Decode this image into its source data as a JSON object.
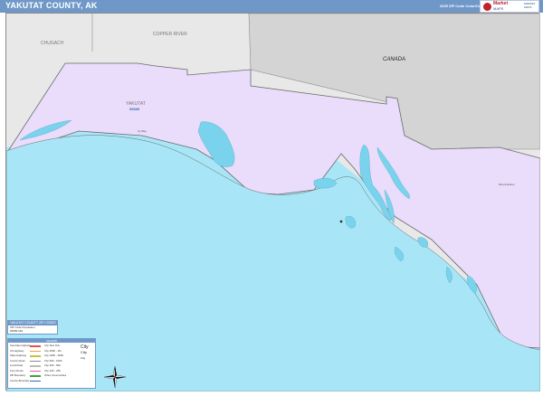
{
  "header": {
    "title": "YAKUTAT COUNTY, AK",
    "edition": "2025 ZIP Code Color/Cast Edition"
  },
  "logo": {
    "brand": "Market",
    "brand2": "MAPS",
    "sub": "MARKET MAPS"
  },
  "map": {
    "labels": {
      "chugach": "CHUGACH",
      "copper_river": "COPPER RIVER",
      "canada": "CANADA",
      "yakutat": "YAKUTAT",
      "zip": "99689",
      "small1": "Icy Bay",
      "small2": "Mount Esther"
    },
    "colors": {
      "ocean": "#a8e6f7",
      "land_county": "#eadcfb",
      "land_other": "#e8e8e8",
      "canada": "#d4d4d4",
      "water_inland": "#7ad3ec",
      "border": "#6a6a6a"
    }
  },
  "legend_zip": {
    "title": "YAKUTAT COUNTY ZIP CODES",
    "rows": [
      "ZIP Code    Population",
      "99689         662"
    ]
  },
  "legend_main": {
    "title": "LEGEND",
    "items_left": [
      "Interstate Highway",
      "US Highway",
      "State Highway",
      "County Road",
      "Local Road",
      "Ferry Route",
      "ZIP Boundary",
      "County Boundary"
    ],
    "items_right": [
      "City Size 1M+",
      "City 250K - 1M",
      "City 100K - 250K",
      "City 50K - 100K",
      "City 25K - 50K",
      "City 10K - 25K",
      "Other Communities"
    ],
    "city_samples": [
      "City",
      "City",
      "City"
    ]
  },
  "compass": {
    "label": "N"
  }
}
